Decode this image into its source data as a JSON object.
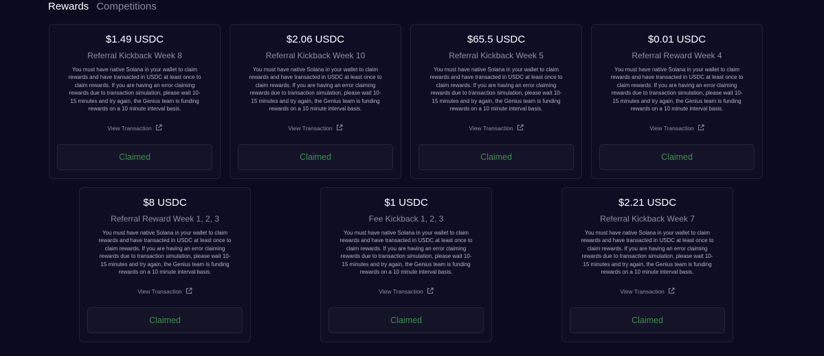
{
  "tabs": [
    {
      "label": "Rewards"
    },
    {
      "label": "Competitions"
    }
  ],
  "cards": [
    {
      "amount": "$1.49 USDC",
      "title": "Referral Kickback Week 8"
    },
    {
      "amount": "$2.06 USDC",
      "title": "Referral Kickback Week 10"
    },
    {
      "amount": "$65.5 USDC",
      "title": "Referral Kickback Week 5"
    },
    {
      "amount": "$0.01 USDC",
      "title": "Referral Reward Week 4"
    },
    {
      "amount": "$8 USDC",
      "title": "Referral Reward Week 1, 2, 3"
    },
    {
      "amount": "$1 USDC",
      "title": "Fee Kickback 1, 2, 3"
    },
    {
      "amount": "$2.21 USDC",
      "title": "Referral Kickback Week 7"
    }
  ],
  "common": {
    "description_lines": [
      "You must have native Solana in your wallet to claim",
      "rewards and have transacted in USDC at least once to",
      "claim rewards. If you are having an error claiming",
      "rewards due to transaction simulation, please wait 10-",
      "15 minutes and try again, the Genius team is funding",
      "rewards on a 10 minute interval basis."
    ],
    "view_transaction_label": "View Transaction",
    "claimed_label": "Claimed",
    "view_transaction_icon": "external-link-icon"
  },
  "colors": {
    "background": "#0b0a1e",
    "card_background": "#0e0d24",
    "card_border": "#22213a",
    "claimed_text": "#3e8f4f",
    "subtitle_text": "#8e8da3"
  }
}
